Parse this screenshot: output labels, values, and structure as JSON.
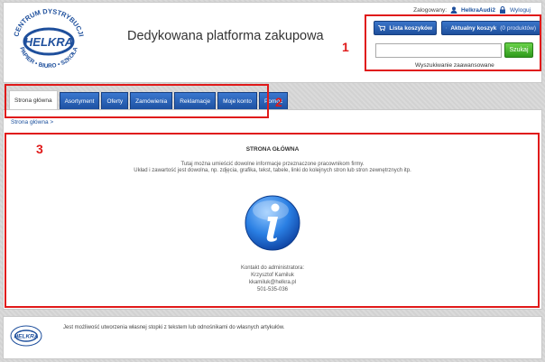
{
  "header": {
    "logo_top_text": "CENTRUM DYSTRYBUCJI",
    "logo_brand": "HELKRA",
    "logo_bottom_text": "PAPIER • BIURO • SZKOŁA",
    "title": "Dedykowana platforma zakupowa",
    "logged_label": "Zalogowany:",
    "username": "HelkraAudi2",
    "logout_label": "Wyloguj",
    "cart_list_label": "Lista koszyków",
    "cart_current_label": "Aktualny koszyk",
    "cart_current_count": "(0 produktów)",
    "search_placeholder": "",
    "search_button": "Szukaj",
    "advanced_search": "Wyszukiwanie zaawansowane"
  },
  "nav": {
    "tabs": [
      {
        "label": "Strona główna"
      },
      {
        "label": "Asortyment"
      },
      {
        "label": "Oferty"
      },
      {
        "label": "Zamówienia"
      },
      {
        "label": "Reklamacje"
      },
      {
        "label": "Moje konto"
      },
      {
        "label": "Pomoc"
      }
    ]
  },
  "main": {
    "breadcrumb": "Strona główna >",
    "title": "STRONA GŁÓWNA",
    "line1": "Tutaj można umieścić dowolne informacje przeznaczone pracownikom firmy.",
    "line2": "Układ i zawartość jest dowolna, np. zdjęcia, grafika, tekst, tabele, linki do kolejnych stron lub stron zewnętrznych itp.",
    "contact_label": "Kontakt do administratora:",
    "contact_name": "Krzysztof Kamiluk",
    "contact_email": "kkamiluk@helkra.pl",
    "contact_phone": "501-535-036"
  },
  "footer": {
    "text": "Jest możliwość utworzenia własnej stopki z tekstem lub odnośnikami do własnych artykułów."
  },
  "annotations": {
    "n1": "1",
    "n2": "2",
    "n3": "3"
  },
  "colors": {
    "brand_blue": "#1e4f9c",
    "search_green": "#2f9a1c",
    "annotation_red": "#e01a1a"
  }
}
